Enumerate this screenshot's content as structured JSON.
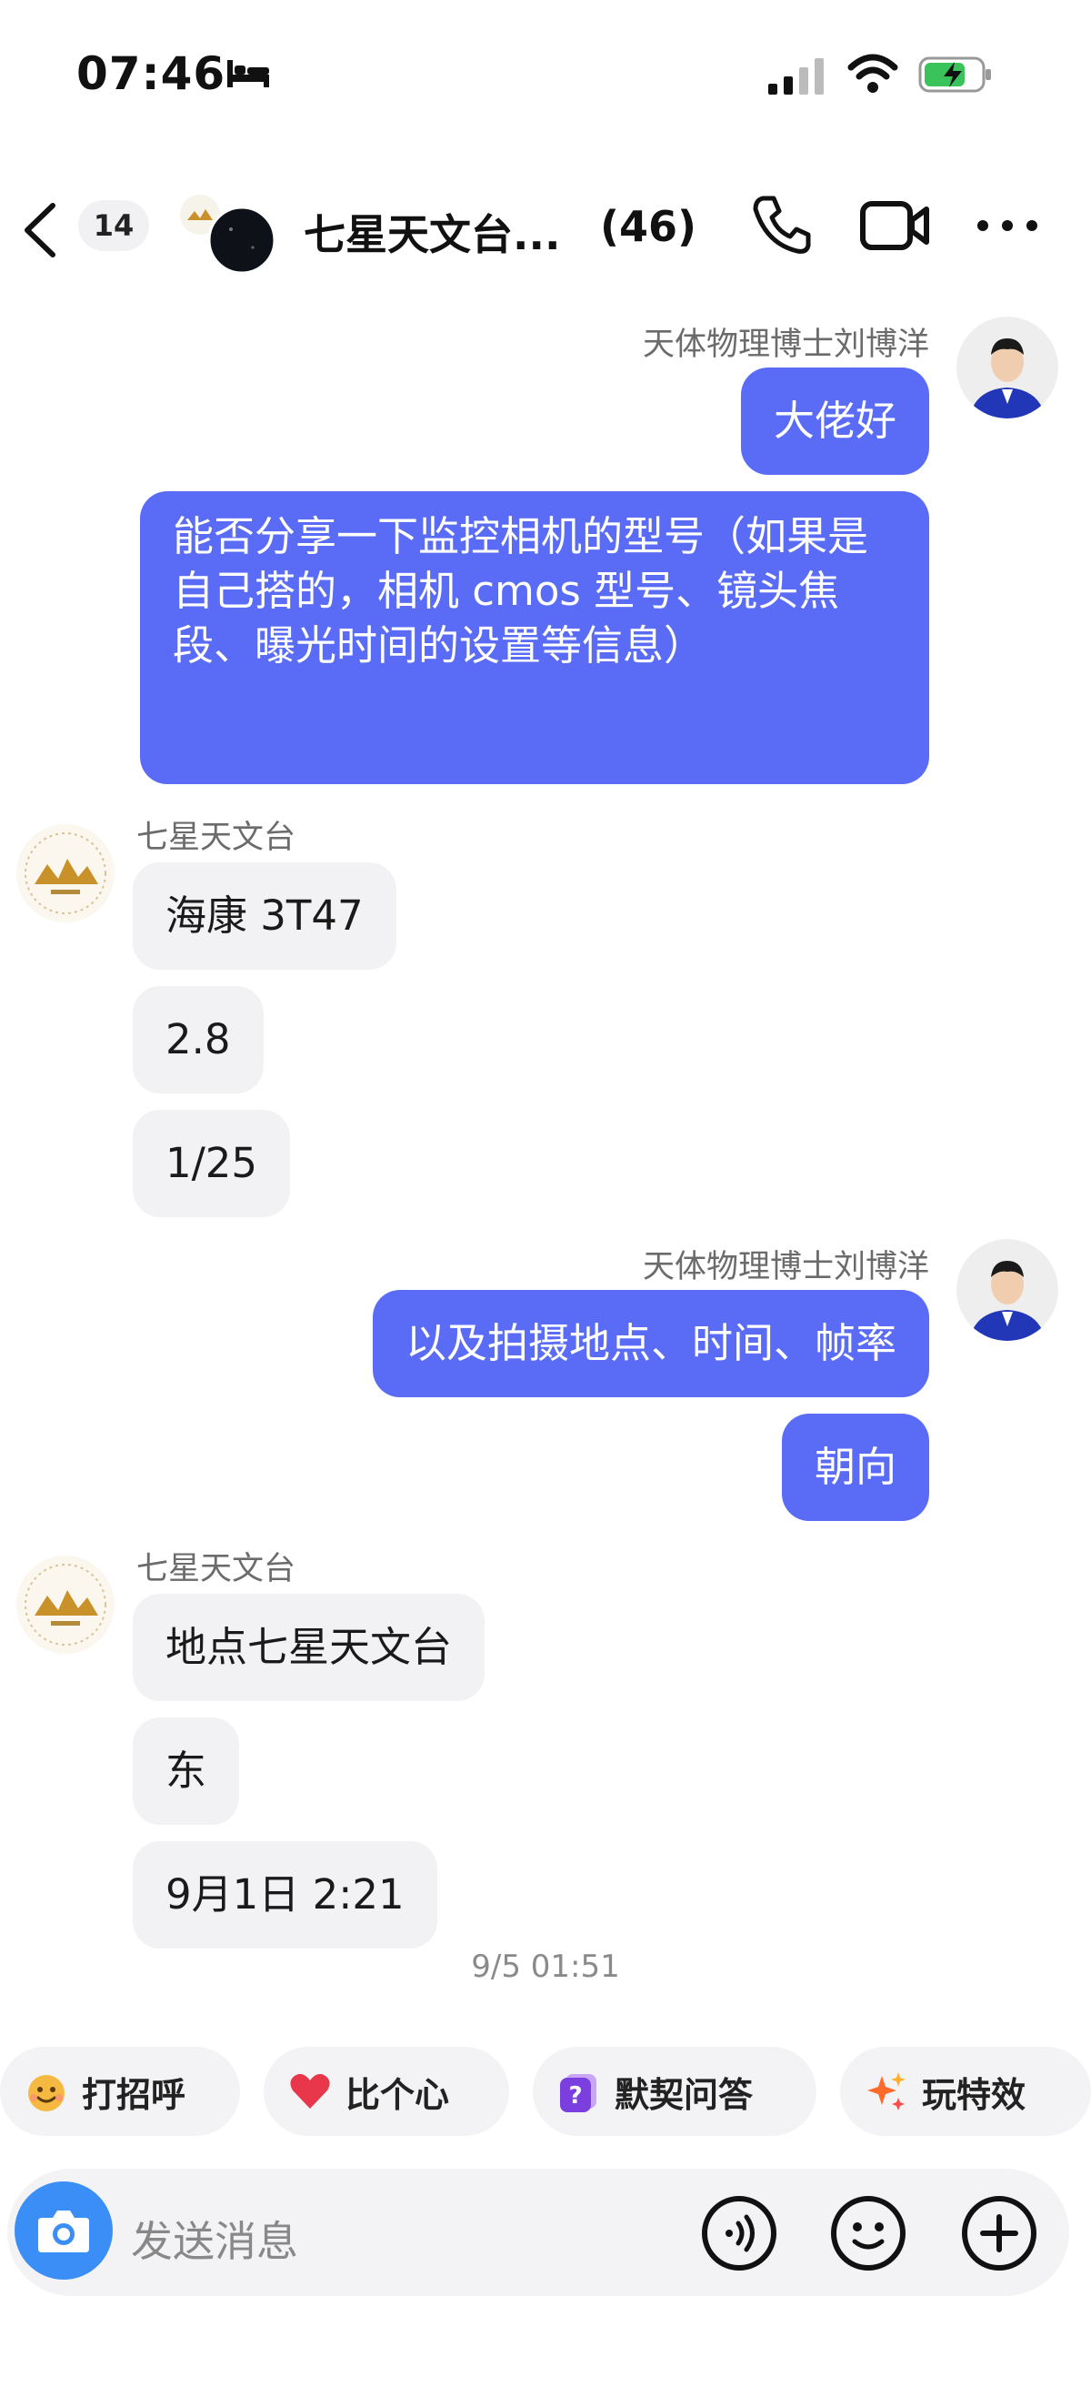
{
  "status_bar": {
    "time": "07:46"
  },
  "header": {
    "unread_count": "14",
    "title": "七星天文台...",
    "member_count": "(46)"
  },
  "messages": [
    {
      "sender": "天体物理博士刘博洋",
      "direction": "out",
      "bubbles": [
        "大佬好",
        "能否分享一下监控相机的型号（如果是自己搭的，相机 cmos 型号、镜头焦段、曝光时间的设置等信息）"
      ]
    },
    {
      "sender": "七星天文台",
      "direction": "in",
      "bubbles": [
        "海康 3T47",
        "2.8",
        "1/25"
      ]
    },
    {
      "sender": "天体物理博士刘博洋",
      "direction": "out",
      "bubbles": [
        "以及拍摄地点、时间、帧率",
        "朝向"
      ]
    },
    {
      "sender": "七星天文台",
      "direction": "in",
      "bubbles": [
        "地点七星天文台",
        "东",
        "9月1日 2:21"
      ]
    }
  ],
  "timestamp": "9/5 01:51",
  "quick_actions": [
    {
      "label": "打招呼",
      "icon": "wave-emoji-icon"
    },
    {
      "label": "比个心",
      "icon": "heart-icon"
    },
    {
      "label": "默契问答",
      "icon": "question-icon"
    },
    {
      "label": "玩特效",
      "icon": "sparkle-icon"
    }
  ],
  "input": {
    "placeholder": "发送消息"
  },
  "colors": {
    "outgoing_bubble": "#5a6cf6",
    "incoming_bubble": "#f2f2f4",
    "camera_button": "#3a8ef6"
  }
}
